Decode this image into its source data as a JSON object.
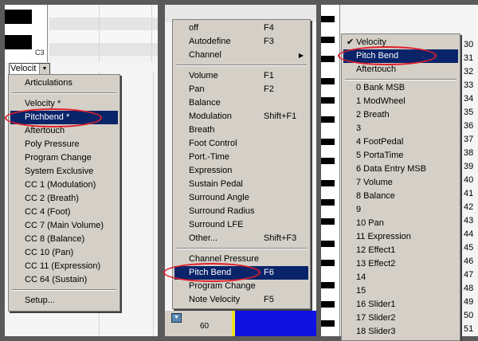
{
  "panel1": {
    "key_label": "C3",
    "combo": {
      "label": "Velocit",
      "arrow_icon": "chevron-down-icon"
    },
    "menu": {
      "items": [
        {
          "label": "Articulations"
        },
        {
          "label": "Velocity *"
        },
        {
          "label": "Pitchbend *",
          "selected": true
        },
        {
          "label": "Aftertouch"
        },
        {
          "label": "Poly Pressure"
        },
        {
          "label": "Program Change"
        },
        {
          "label": "System Exclusive"
        },
        {
          "label": "CC 1  (Modulation)"
        },
        {
          "label": "CC 2  (Breath)"
        },
        {
          "label": "CC 4  (Foot)"
        },
        {
          "label": "CC 7  (Main Volume)"
        },
        {
          "label": "CC 8  (Balance)"
        },
        {
          "label": "CC 10  (Pan)"
        },
        {
          "label": "CC 11  (Expression)"
        },
        {
          "label": "CC 64  (Sustain)"
        },
        {
          "label": "Setup..."
        }
      ]
    }
  },
  "panel2": {
    "ruler_value": "60",
    "menu": {
      "items": [
        {
          "label": "off",
          "shortcut": "F4"
        },
        {
          "label": "Autodefine",
          "shortcut": "F3"
        },
        {
          "label": "Channel",
          "shortcut": ""
        },
        {
          "label": "Volume",
          "shortcut": "F1"
        },
        {
          "label": "Pan",
          "shortcut": "F2"
        },
        {
          "label": "Balance",
          "shortcut": ""
        },
        {
          "label": "Modulation",
          "shortcut": "Shift+F1"
        },
        {
          "label": "Breath",
          "shortcut": ""
        },
        {
          "label": "Foot Control",
          "shortcut": ""
        },
        {
          "label": "Port.-Time",
          "shortcut": ""
        },
        {
          "label": "Expression",
          "shortcut": ""
        },
        {
          "label": "Sustain Pedal",
          "shortcut": ""
        },
        {
          "label": "Surround Angle",
          "shortcut": ""
        },
        {
          "label": "Surround Radius",
          "shortcut": ""
        },
        {
          "label": "Surround LFE",
          "shortcut": ""
        },
        {
          "label": "Other...",
          "shortcut": "Shift+F3"
        },
        {
          "label": "Channel Pressure",
          "shortcut": ""
        },
        {
          "label": "Pitch Bend",
          "shortcut": "F6",
          "selected": true
        },
        {
          "label": "Program Change",
          "shortcut": ""
        },
        {
          "label": "Note Velocity",
          "shortcut": "F5"
        }
      ]
    }
  },
  "panel3": {
    "menu": {
      "items": [
        {
          "label": "Velocity",
          "checked": true
        },
        {
          "label": "Pitch Bend",
          "selected": true
        },
        {
          "label": "Aftertouch"
        },
        {
          "label": "0 Bank MSB"
        },
        {
          "label": "1 ModWheel"
        },
        {
          "label": "2 Breath"
        },
        {
          "label": "3"
        },
        {
          "label": "4 FootPedal"
        },
        {
          "label": "5 PortaTime"
        },
        {
          "label": "6 Data Entry MSB"
        },
        {
          "label": "7 Volume"
        },
        {
          "label": "8 Balance"
        },
        {
          "label": "9"
        },
        {
          "label": "10 Pan"
        },
        {
          "label": "11 Expression"
        },
        {
          "label": "12 Effect1"
        },
        {
          "label": "13 Effect2"
        },
        {
          "label": "14"
        },
        {
          "label": "15"
        },
        {
          "label": "16 Slider1"
        },
        {
          "label": "17 Slider2"
        },
        {
          "label": "18 Slider3"
        }
      ]
    },
    "right_numbers": [
      "30",
      "31",
      "32",
      "33",
      "34",
      "35",
      "36",
      "37",
      "38",
      "39",
      "40",
      "41",
      "42",
      "43",
      "44",
      "45",
      "46",
      "47",
      "48",
      "49",
      "50",
      "51"
    ]
  },
  "colors": {
    "menu_bg": "#d4d0c8",
    "selection": "#0a246a",
    "highlight_circle": "#e0202a",
    "ruler_blue": "#1010e0"
  }
}
